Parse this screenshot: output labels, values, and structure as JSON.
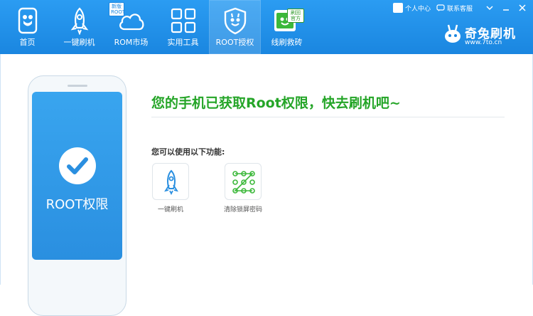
{
  "nav": {
    "items": [
      {
        "label": "首页",
        "icon": "phone-home-icon"
      },
      {
        "label": "一键刷机",
        "icon": "rocket-icon"
      },
      {
        "label": "ROM市场",
        "icon": "cloud-icon",
        "badge": "新版\nROOT"
      },
      {
        "label": "实用工具",
        "icon": "grid-tools-icon"
      },
      {
        "label": "ROOT授权",
        "icon": "shield-rabbit-icon",
        "active": true
      },
      {
        "label": "线刷救砖",
        "icon": "flash-tool-icon",
        "badge": "刷回\n官方"
      }
    ]
  },
  "titlebar": {
    "personal_center": "个人中心",
    "contact_support": "联系客服"
  },
  "brand": {
    "name": "奇兔刷机",
    "url": "www.7to.cn"
  },
  "main": {
    "phone_label": "ROOT权限",
    "headline": "您的手机已获取Root权限，快去刷机吧~",
    "features_title": "您可以使用以下功能:",
    "features": [
      {
        "label": "一键刷机",
        "icon": "rocket-icon"
      },
      {
        "label": "清除锁屏密码",
        "icon": "pattern-lock-icon"
      }
    ]
  },
  "colors": {
    "topbar": "#1a86e0",
    "accent_green": "#25a528",
    "phone_screen": "#2a8fe0"
  }
}
